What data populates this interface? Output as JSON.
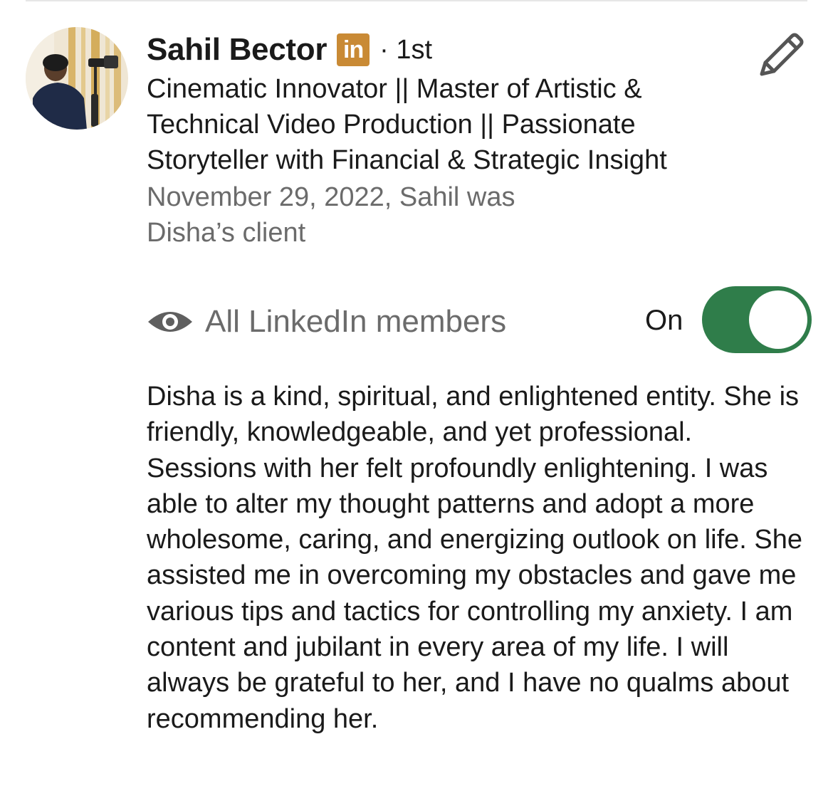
{
  "recommendation": {
    "author": {
      "name": "Sahil Bector",
      "badge_text": "in",
      "connection_degree": "· 1st",
      "headline": "Cinematic Innovator || Master of Artistic & Technical Video Production || Passionate Storyteller with Financial & Strategic Insight",
      "relation": "November 29, 2022, Sahil was Disha’s client"
    },
    "visibility": {
      "icon": "eye-icon",
      "label": "All LinkedIn members",
      "state_label": "On",
      "enabled": true
    },
    "text": "Disha is a kind, spiritual, and enlightened entity. She is friendly, knowledgeable, and yet professional. Sessions with her felt profoundly enlightening. I was able to alter my thought patterns and adopt a more wholesome, caring, and energizing outlook on life. She assisted me in overcoming my obstacles and gave me various tips and tactics for controlling my anxiety. I am content and jubilant in every area of my life. I will always be grateful to her, and I have no qualms about recommending her."
  },
  "colors": {
    "toggle_on": "#2f7d4a",
    "linkedin_badge": "#c98a35",
    "secondary_text": "#6b6b6b"
  }
}
